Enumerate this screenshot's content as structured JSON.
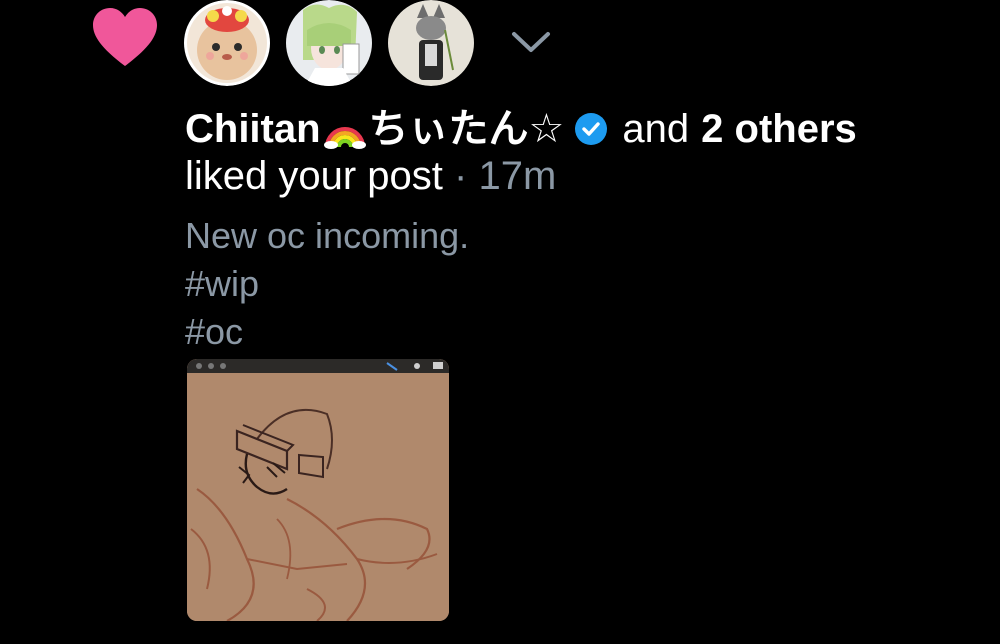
{
  "notification": {
    "type": "like",
    "user_name": "Chiitan",
    "user_name_suffix": "ちぃたん☆",
    "and_text": "and",
    "others_text": "2 others",
    "action_text": "liked your post",
    "separator": "·",
    "time_ago": "17m"
  },
  "post": {
    "lines": [
      "New oc incoming.",
      "#wip",
      "#oc"
    ]
  },
  "colors": {
    "heart": "#f0579a",
    "verified": "#1d9bf0",
    "muted_text": "#8b98a5",
    "background": "#000000"
  },
  "icons": {
    "like": "heart-icon",
    "expand": "chevron-down-icon",
    "verified": "verified-badge-icon",
    "rainbow": "rainbow-emoji-icon"
  }
}
